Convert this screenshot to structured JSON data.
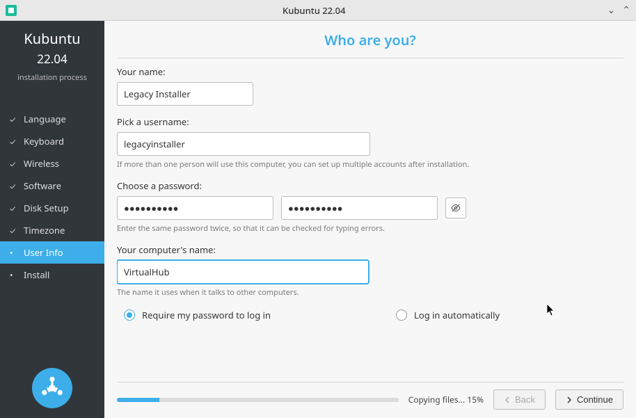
{
  "titlebar": {
    "title": "Kubuntu 22.04"
  },
  "sidebar": {
    "heading": "Kubuntu",
    "version": "22.04",
    "subtitle": "installation process",
    "steps": [
      {
        "label": "Language",
        "done": true,
        "current": false
      },
      {
        "label": "Keyboard",
        "done": true,
        "current": false
      },
      {
        "label": "Wireless",
        "done": true,
        "current": false
      },
      {
        "label": "Software",
        "done": true,
        "current": false
      },
      {
        "label": "Disk Setup",
        "done": true,
        "current": false
      },
      {
        "label": "Timezone",
        "done": true,
        "current": false
      },
      {
        "label": "User Info",
        "done": false,
        "current": true
      },
      {
        "label": "Install",
        "done": false,
        "current": false
      }
    ]
  },
  "main": {
    "title": "Who are you?",
    "name_label": "Your name:",
    "name_value": "Legacy Installer",
    "username_label": "Pick a username:",
    "username_value": "legacyinstaller",
    "username_hint": "If more than one person will use this computer, you can set up multiple accounts after installation.",
    "password_label": "Choose a password:",
    "password_value": "●●●●●●●●●●",
    "password_confirm_value": "●●●●●●●●●●",
    "password_hint": "Enter the same password twice, so that it can be checked for typing errors.",
    "computer_label": "Your computer's name:",
    "computer_value": "VirtualHub",
    "computer_hint": "The name it uses when it talks to other computers.",
    "login_option_require": "Require my password to log in",
    "login_option_auto": "Log in automatically"
  },
  "footer": {
    "progress_text": "Copying files... 15%",
    "progress_percent": 15,
    "back_label": "Back",
    "continue_label": "Continue"
  }
}
